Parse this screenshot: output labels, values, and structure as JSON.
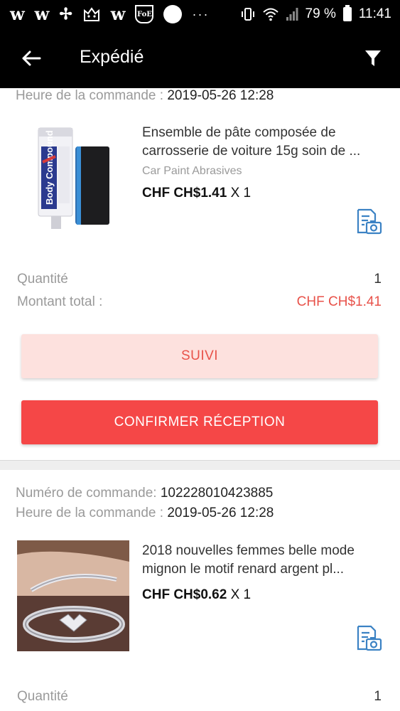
{
  "status_bar": {
    "app_icons": [
      "w",
      "w",
      "✢",
      "cat",
      "w",
      "FoE",
      "circle"
    ],
    "more": "···",
    "battery": "79 %",
    "time": "11:41"
  },
  "header": {
    "title": "Expédié",
    "back_icon": "arrow-left-icon",
    "filter_icon": "filter-funnel-icon"
  },
  "orders": [
    {
      "order_time_label": "Heure de la commande :",
      "order_time": "2019-05-26 12:28",
      "product": {
        "title_line1": "Ensemble de pâte composée de",
        "title_line2": "carrosserie de voiture 15g soin de ...",
        "category": "Car Paint Abrasives",
        "price": "CHF CH$1.41",
        "qty": "X 1",
        "thumb_label": "Body Compound"
      },
      "quantity_label": "Quantité",
      "quantity": "1",
      "total_label": "Montant total :",
      "total": "CHF CH$1.41",
      "track_button": "SUIVI",
      "confirm_button": "CONFIRMER RÉCEPTION"
    },
    {
      "order_number_label": "Numéro de commande:",
      "order_number": "102228010423885",
      "order_time_label": "Heure de la commande :",
      "order_time": "2019-05-26 12:28",
      "product": {
        "title_line1": "2018 nouvelles femmes belle mode",
        "title_line2": "mignon le motif renard argent pl...",
        "price": "CHF CH$0.62",
        "qty": "X 1"
      },
      "quantity_label": "Quantité",
      "quantity": "1"
    }
  ],
  "colors": {
    "accent_red": "#f54747",
    "price_red": "#e8524a",
    "track_bg": "#fde1de",
    "icon_blue": "#3b82c4"
  }
}
